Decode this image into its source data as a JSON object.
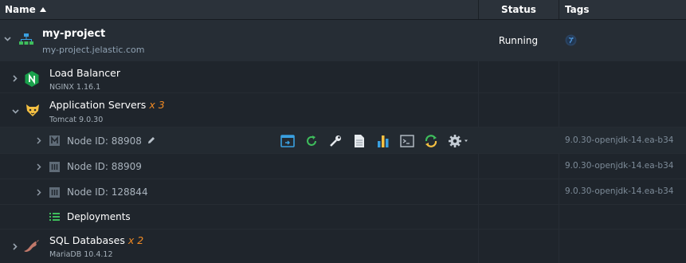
{
  "header": {
    "name_label": "Name",
    "status_label": "Status",
    "tags_label": "Tags"
  },
  "environment": {
    "name": "my-project",
    "url": "my-project.jelastic.com",
    "status": "Running",
    "tag_icon": "globe-icon"
  },
  "groups": {
    "load_balancer": {
      "title": "Load Balancer",
      "subtitle": "NGINX 1.16.1",
      "icon": "nginx-icon"
    },
    "app_servers": {
      "title": "Application Servers",
      "multiplier": "x 3",
      "subtitle": "Tomcat 9.0.30",
      "icon": "tomcat-icon"
    },
    "sql_databases": {
      "title": "SQL Databases",
      "multiplier": "x 2",
      "subtitle": "MariaDB 10.4.12",
      "icon": "mariadb-icon"
    }
  },
  "nodes": [
    {
      "label": "Node ID: 88908",
      "tag": "9.0.30-openjdk-14.ea-b34",
      "master": true
    },
    {
      "label": "Node ID: 88909",
      "tag": "9.0.30-openjdk-14.ea-b34",
      "master": false
    },
    {
      "label": "Node ID: 128844",
      "tag": "9.0.30-openjdk-14.ea-b34",
      "master": false
    }
  ],
  "deployments": {
    "label": "Deployments",
    "icon": "deployments-icon"
  },
  "node_tools": [
    "web-ssh-open-icon",
    "restart-icon",
    "config-icon",
    "log-icon",
    "statistics-icon",
    "web-ssh-icon",
    "redeploy-icon",
    "settings-gear-icon"
  ],
  "colors": {
    "background": "#1f252c",
    "header": "#2b323a",
    "accent_blue": "#3aa0e0",
    "running": "#ffffff",
    "multiplier": "#f08a24"
  }
}
